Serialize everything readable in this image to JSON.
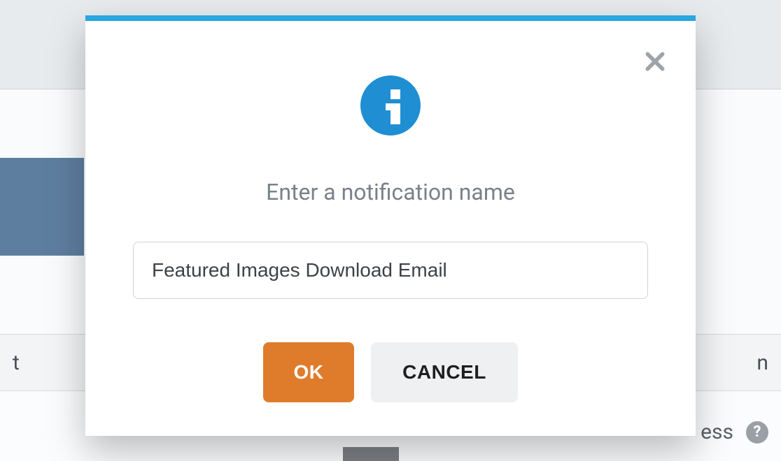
{
  "modal": {
    "accent_color": "#2aa6e1",
    "info_badge_color": "#1f8ed2",
    "prompt": "Enter a notification name",
    "input_value": "Featured Images Download Email",
    "input_placeholder": "",
    "ok_label": "OK",
    "cancel_label": "CANCEL"
  },
  "background": {
    "row_fragment_left": "t",
    "row_fragment_right": "n",
    "bottom_fragment": "ess",
    "help_icon": "?"
  }
}
